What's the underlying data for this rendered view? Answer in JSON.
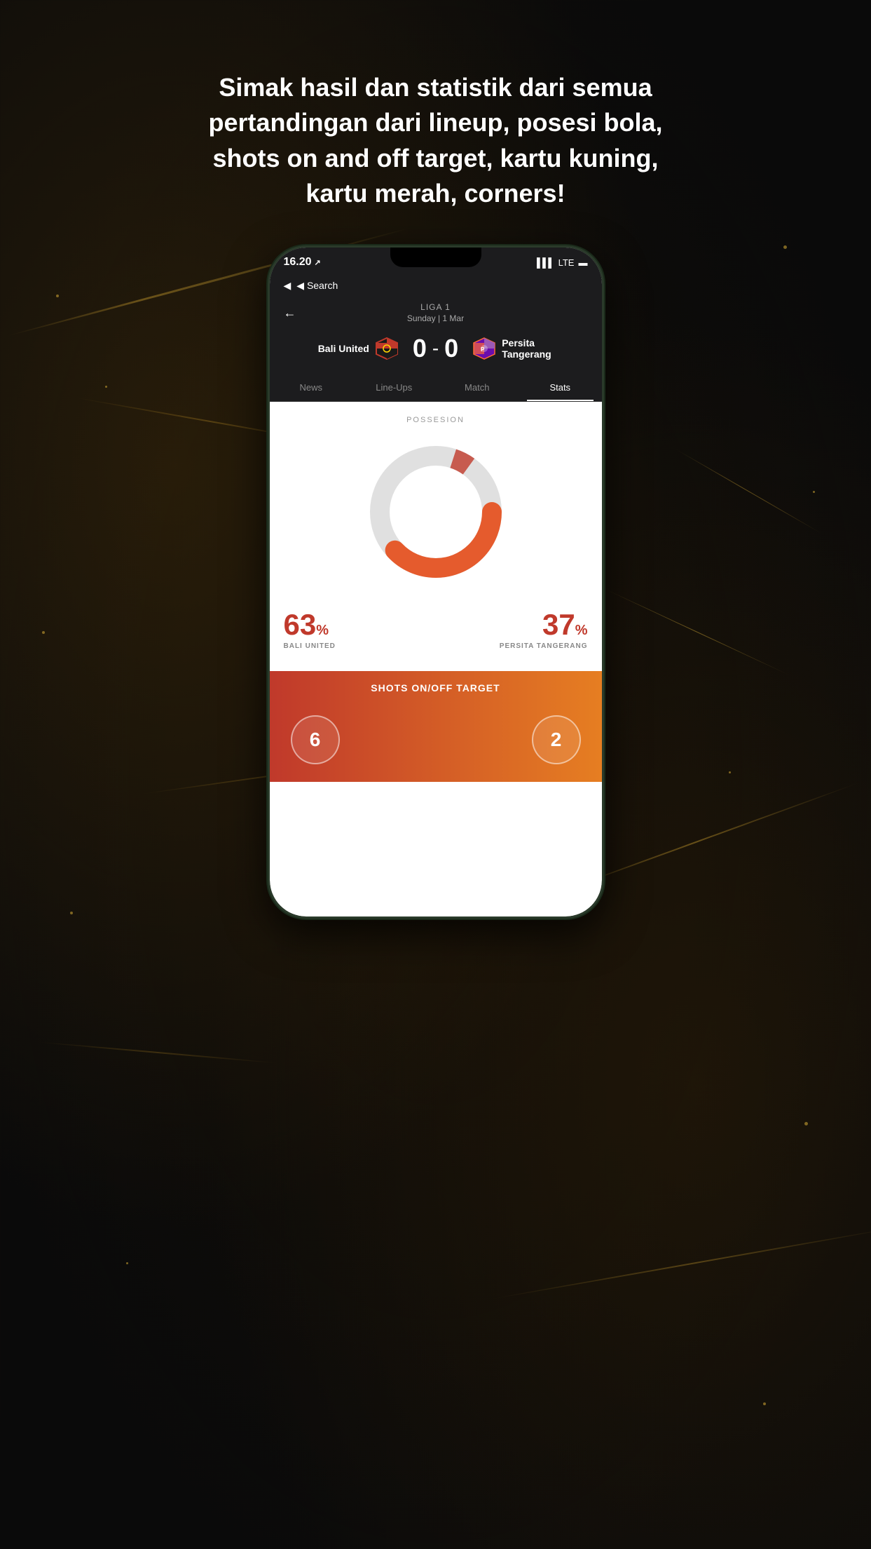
{
  "background": {
    "color": "#0a0a0a"
  },
  "headline": {
    "text": "Simak hasil dan statistik dari semua pertandingan dari lineup, posesi bola, shots on and off target, kartu kuning, kartu merah, corners!"
  },
  "phone": {
    "status_bar": {
      "time": "16.20",
      "direction_icon": "↗",
      "signal": "▌▌▌",
      "network": "LTE",
      "battery": "🔋"
    },
    "nav": {
      "back_label": "◀ Search"
    },
    "match_header": {
      "league": "LIGA 1",
      "date": "Sunday | 1 Mar",
      "back_arrow": "←"
    },
    "score": {
      "home_team": "Bali United",
      "home_score": "0",
      "separator": "-",
      "away_score": "0",
      "away_team_line1": "Persita",
      "away_team_line2": "Tangerang"
    },
    "tabs": [
      {
        "label": "News",
        "active": false
      },
      {
        "label": "Line-Ups",
        "active": false
      },
      {
        "label": "Match",
        "active": false
      },
      {
        "label": "Stats",
        "active": true
      }
    ],
    "possesion": {
      "title": "POSSESION",
      "home_percent": "63",
      "home_percent_symbol": "%",
      "home_team": "BALI UNITED",
      "away_percent": "37",
      "away_percent_symbol": "%",
      "away_team": "PERSITA TANGERANG",
      "home_value": 63,
      "away_value": 37
    },
    "shots": {
      "title": "SHOTS ON/OFF TARGET",
      "home_value": "6",
      "away_value": "2"
    }
  }
}
